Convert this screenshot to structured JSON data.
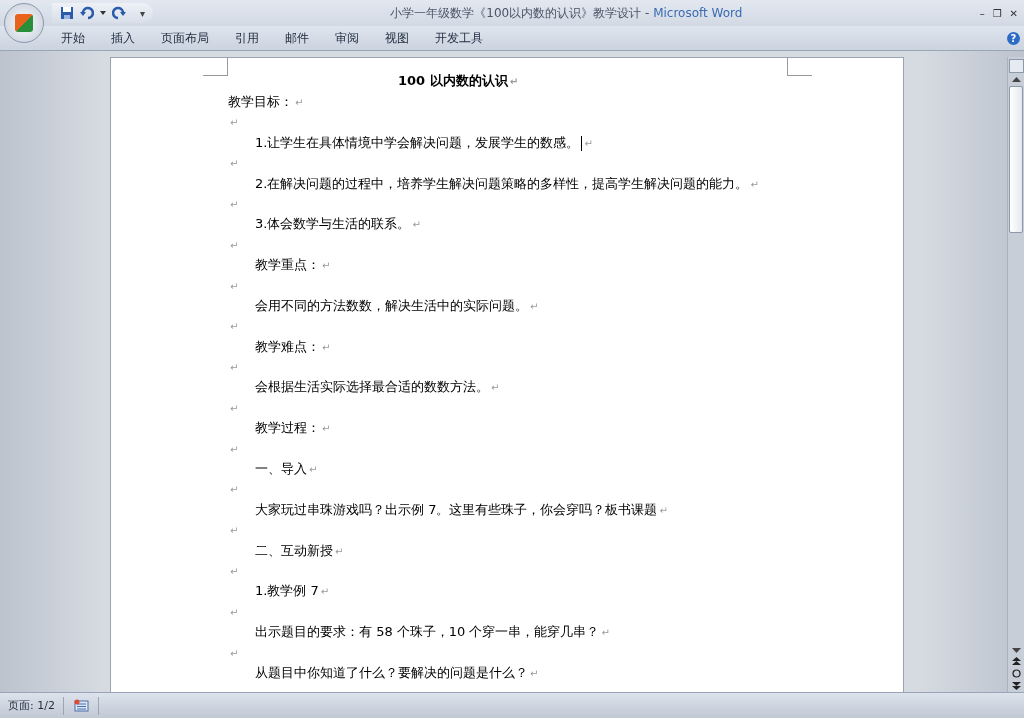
{
  "window": {
    "title": "小学一年级数学《100以内数的认识》教学设计",
    "separator": "-",
    "app": "Microsoft Word",
    "quick_access": {
      "menu_glyph": "▾"
    },
    "controls": [
      "–",
      "❐",
      "✕"
    ]
  },
  "ribbon_tabs": [
    {
      "label": "开始",
      "selected": false
    },
    {
      "label": "插入",
      "selected": false
    },
    {
      "label": "页面布局",
      "selected": false
    },
    {
      "label": "引用",
      "selected": false
    },
    {
      "label": "邮件",
      "selected": false
    },
    {
      "label": "审阅",
      "selected": false
    },
    {
      "label": "视图",
      "selected": false
    },
    {
      "label": "开发工具",
      "selected": false
    }
  ],
  "help": "?",
  "document": {
    "heading": "100 以内数的认识",
    "paragraphs": [
      {
        "kind": "plain",
        "text": "教学目标：",
        "cursor": false
      },
      {
        "kind": "empty",
        "cursor": false
      },
      {
        "kind": "indented",
        "text": "1.让学生在具体情境中学会解决问题，发展学生的数感。",
        "cursor": true
      },
      {
        "kind": "empty",
        "cursor": false
      },
      {
        "kind": "indented",
        "text": "2.在解决问题的过程中，培养学生解决问题策略的多样性，提高学生解决问题的能力。",
        "cursor": false
      },
      {
        "kind": "empty",
        "cursor": false
      },
      {
        "kind": "indented",
        "text": "3.体会数学与生活的联系。",
        "cursor": false
      },
      {
        "kind": "empty",
        "cursor": false
      },
      {
        "kind": "indented",
        "text": "教学重点：",
        "cursor": false
      },
      {
        "kind": "empty",
        "cursor": false
      },
      {
        "kind": "indented",
        "text": "会用不同的方法数数，解决生活中的实际问题。",
        "cursor": false
      },
      {
        "kind": "empty",
        "cursor": false
      },
      {
        "kind": "indented",
        "text": "教学难点：",
        "cursor": false
      },
      {
        "kind": "empty",
        "cursor": false
      },
      {
        "kind": "indented",
        "text": "会根据生活实际选择最合适的数数方法。",
        "cursor": false
      },
      {
        "kind": "empty",
        "cursor": false
      },
      {
        "kind": "indented",
        "text": "教学过程：",
        "cursor": false
      },
      {
        "kind": "empty",
        "cursor": false
      },
      {
        "kind": "indented",
        "text": "一、导入",
        "cursor": false
      },
      {
        "kind": "empty",
        "cursor": false
      },
      {
        "kind": "indented",
        "text": "大家玩过串珠游戏吗？出示例 7。这里有些珠子，你会穿吗？板书课题",
        "cursor": false
      },
      {
        "kind": "empty",
        "cursor": false
      },
      {
        "kind": "indented",
        "text": "二、互动新授",
        "cursor": false
      },
      {
        "kind": "empty",
        "cursor": false
      },
      {
        "kind": "indented",
        "text": "1.教学例 7",
        "cursor": false
      },
      {
        "kind": "empty",
        "cursor": false
      },
      {
        "kind": "indented",
        "text": "出示题目的要求：有 58 个珠子，10 个穿一串，能穿几串？",
        "cursor": false
      },
      {
        "kind": "empty",
        "cursor": false
      },
      {
        "kind": "indented",
        "text": "从题目中你知道了什么？要解决的问题是什么？",
        "cursor": false
      }
    ],
    "paragraph_mark": "↵"
  },
  "status_bar": {
    "page": "页面: 1/2"
  }
}
